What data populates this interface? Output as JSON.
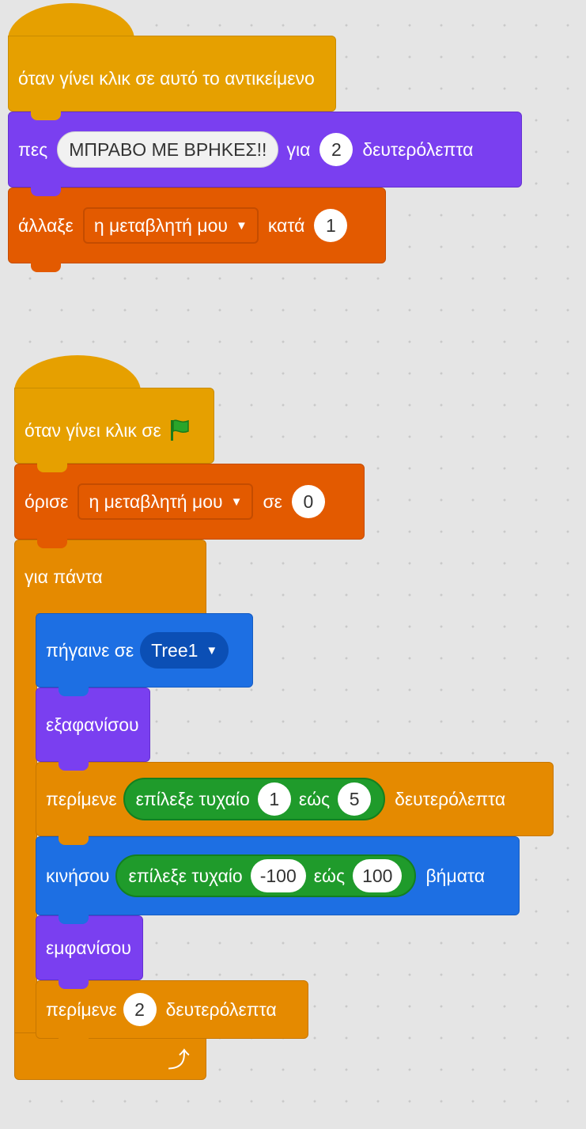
{
  "script1": {
    "hat_label": "όταν γίνει κλικ σε αυτό το αντικείμενο",
    "say": {
      "label": "πες",
      "message": "ΜΠΡΑΒΟ ΜΕ ΒΡΗΚΕΣ!!",
      "for_label": "για",
      "seconds": "2",
      "seconds_label": "δευτερόλεπτα"
    },
    "change": {
      "label": "άλλαξε",
      "variable": "η μεταβλητή μου",
      "by_label": "κατά",
      "value": "1"
    }
  },
  "script2": {
    "hat_label": "όταν γίνει κλικ σε",
    "set": {
      "label": "όρισε",
      "variable": "η μεταβλητή μου",
      "to_label": "σε",
      "value": "0"
    },
    "forever_label": "για πάντα",
    "goto": {
      "label": "πήγαινε σε",
      "target": "Tree1"
    },
    "hide_label": "εξαφανίσου",
    "wait_random": {
      "label": "περίμενε",
      "pick_label": "επίλεξε τυχαίο",
      "from": "1",
      "to_label": "εώς",
      "to": "5",
      "seconds_label": "δευτερόλεπτα"
    },
    "move": {
      "label": "κινήσου",
      "pick_label": "επίλεξε τυχαίο",
      "from": "-100",
      "to_label": "εώς",
      "to": "100",
      "steps_label": "βήματα"
    },
    "show_label": "εμφανίσου",
    "wait": {
      "label": "περίμενε",
      "seconds": "2",
      "seconds_label": "δευτερόλεπτα"
    }
  },
  "icons": {
    "flag": "green-flag-icon",
    "dropdown": "caret-down-icon",
    "loop": "loop-arrow-icon"
  },
  "colors": {
    "events": "#e6a000",
    "looks": "#7a3ff0",
    "variables": "#e35a00",
    "control": "#e58a00",
    "motion": "#1d6fe3",
    "operators": "#1f9b2b",
    "flag": "#2aa52a"
  }
}
